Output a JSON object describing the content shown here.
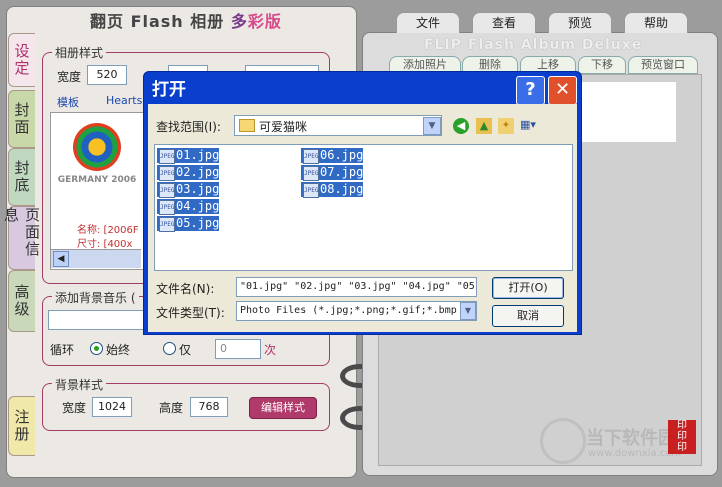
{
  "app": {
    "title_main": "翻页 Flash 相册 ",
    "title_accent1": "多",
    "title_accent2": "彩版",
    "subtitle_en": "FLIP Flash Album Deluxe"
  },
  "side_tabs": [
    "设定",
    "封面",
    "封底",
    "页面信息",
    "高级",
    "注册"
  ],
  "album_style": {
    "legend": "相册样式",
    "width_label": "宽度",
    "width_value": "520",
    "template_label": "模板",
    "template_value": "Hearts",
    "thumb_caption": "GERMANY 2006",
    "name_label": "名称: [2006F",
    "size_label": "尺寸: [400x"
  },
  "music": {
    "legend": "添加背景音乐 (",
    "loop_label": "循环",
    "always_label": "始终",
    "only_label": "仅",
    "count_value": "0",
    "times_label": "次"
  },
  "background": {
    "legend": "背景样式",
    "width_label": "宽度",
    "width_value": "1024",
    "height_label": "高度",
    "height_value": "768",
    "edit_button": "编辑样式"
  },
  "menu_tabs": [
    "文件",
    "查看",
    "预览",
    "帮助"
  ],
  "toolbar": [
    "添加照片",
    "删除",
    "上移",
    "下移",
    "预览窗口"
  ],
  "dialog": {
    "title": "打开",
    "help_btn": "?",
    "close_btn": "✕",
    "lookin_label": "查找范围(I):",
    "lookin_value": "可爱猫咪",
    "files_col1": [
      "01.jpg",
      "02.jpg",
      "03.jpg",
      "04.jpg",
      "05.jpg"
    ],
    "files_col2": [
      "06.jpg",
      "07.jpg",
      "08.jpg"
    ],
    "filename_label": "文件名(N):",
    "filename_value": "\"01.jpg\" \"02.jpg\" \"03.jpg\" \"04.jpg\" \"05",
    "filetype_label": "文件类型(T):",
    "filetype_value": "Photo Files (*.jpg;*.png;*.gif;*.bmp",
    "open_button": "打开(O)",
    "cancel_button": "取消"
  },
  "watermark": {
    "cn": "当下软件园",
    "url": "www.downxia.com"
  }
}
